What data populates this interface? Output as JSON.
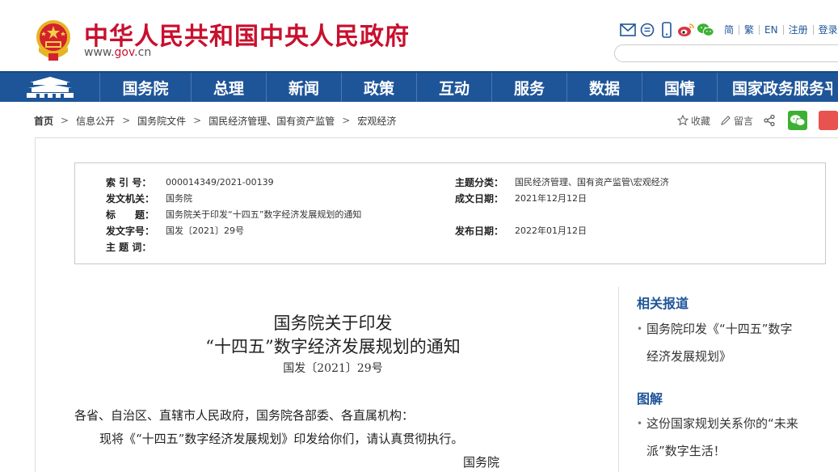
{
  "header": {
    "site_title": "中华人民共和国中央人民政府",
    "site_url_prefix": "www.",
    "site_url_accent": "gov",
    "site_url_suffix": ".cn",
    "tools": [
      {
        "icon": "mail-icon"
      },
      {
        "icon": "message-icon"
      },
      {
        "icon": "mobile-icon"
      },
      {
        "icon": "weibo-icon"
      },
      {
        "icon": "wechat-icon"
      }
    ],
    "languages": [
      "简",
      "繁",
      "EN",
      "注册",
      "登录"
    ],
    "colors": {
      "brand_red": "#c8102e",
      "nav_blue": "#1e5598"
    }
  },
  "nav": {
    "home_icon": "tiananmen-icon",
    "items": [
      "国务院",
      "总理",
      "新闻",
      "政策",
      "互动",
      "服务",
      "数据",
      "国情",
      "国家政务服务平台"
    ]
  },
  "breadcrumb": {
    "items": [
      "首页",
      "信息公开",
      "国务院文件",
      "国民经济管理、国有资产监管",
      "宏观经济"
    ],
    "separator": ">"
  },
  "actions": {
    "favorite": "收藏",
    "comment": "留言"
  },
  "meta": {
    "index_label": "索 引 号：",
    "index_value": "000014349/2021-00139",
    "topic_label": "主题分类：",
    "topic_value": "国民经济管理、国有资产监管\\宏观经济",
    "issuer_label": "发文机关：",
    "issuer_value": "国务院",
    "created_label": "成文日期：",
    "created_value": "2021年12月12日",
    "title_label": "标　　题：",
    "title_value": "国务院关于印发“十四五”数字经济发展规划的通知",
    "docno_label": "发文字号：",
    "docno_value": "国发〔2021〕29号",
    "published_label": "发布日期：",
    "published_value": "2022年01月12日",
    "keywords_label": "主 题 词：",
    "keywords_value": ""
  },
  "article": {
    "title_line1": "国务院关于印发",
    "title_line2": "“十四五”数字经济发展规划的通知",
    "doc_no": "国发〔2021〕29号",
    "salutation": "各省、自治区、直辖市人民政府，国务院各部委、各直属机构：",
    "body": "现将《“十四五”数字经济发展规划》印发给你们，请认真贯彻执行。",
    "signature": "国务院"
  },
  "sidebar": {
    "related_title": "相关报道",
    "related_item_line1": "国务院印发《“十四五”数字",
    "related_item_line2": "经济发展规划》",
    "illustration_title": "图解",
    "illustration_item_line1": "这份国家规划关系你的“未来",
    "illustration_item_line2": "派”数字生活！"
  }
}
